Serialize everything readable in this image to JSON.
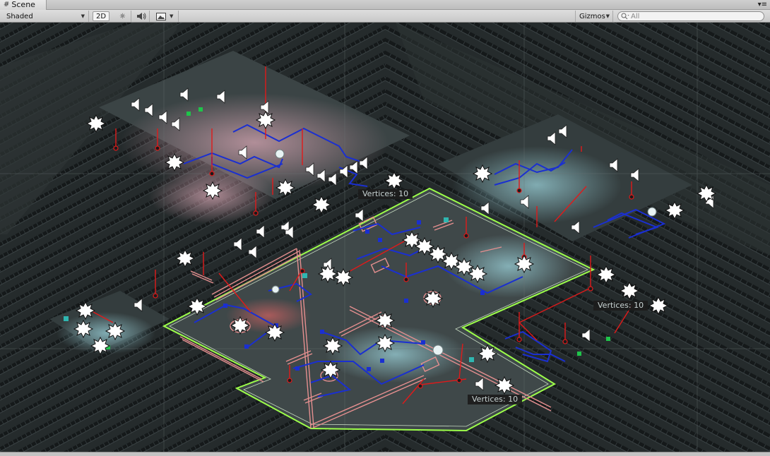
{
  "window": {
    "tab_icon": "grid-hash-icon",
    "tab_label": "Scene",
    "menu_icon": "panel-menu-icon"
  },
  "toolbar": {
    "draw_mode": "Shaded",
    "mode_2d": "2D",
    "lighting_icon": "sun-icon",
    "audio_icon": "speaker-icon",
    "effects_icon": "image-icon",
    "gizmos_label": "Gizmos",
    "search_icon": "search-icon",
    "search_placeholder": "All"
  },
  "scene": {
    "vertex_labels": [
      "Vertices: 10",
      "Vertices: 10",
      "Vertices: 10"
    ],
    "icons": {
      "light": "light-burst-icon",
      "audio": "audio-source-icon"
    },
    "colors": {
      "floor": "#2a3031",
      "shelf": "#171b1c",
      "navmesh_outline": "#9dff4a",
      "path_lines": "#1a2fd1",
      "gizmo_red": "#e01a1a",
      "highlight_pink": "#e58f8f"
    }
  }
}
